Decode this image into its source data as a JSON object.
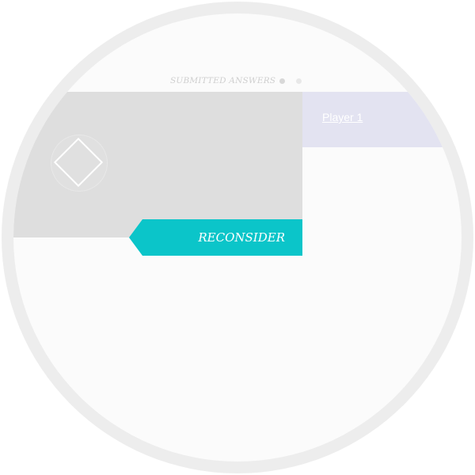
{
  "header": {
    "title": "SUBMITTED ANSWERS",
    "pager_dots": 2,
    "active_dot": 1
  },
  "answer_card": {
    "icon": "diamond-icon"
  },
  "player": {
    "name": "Player 1"
  },
  "actions": {
    "reconsider_label": "RECONSIDER"
  },
  "colors": {
    "accent": "#0bc5c9",
    "card_bg": "#dedede",
    "player_panel_bg": "#e3e3f1",
    "frame": "#ededed",
    "surface": "#fbfbfb"
  }
}
